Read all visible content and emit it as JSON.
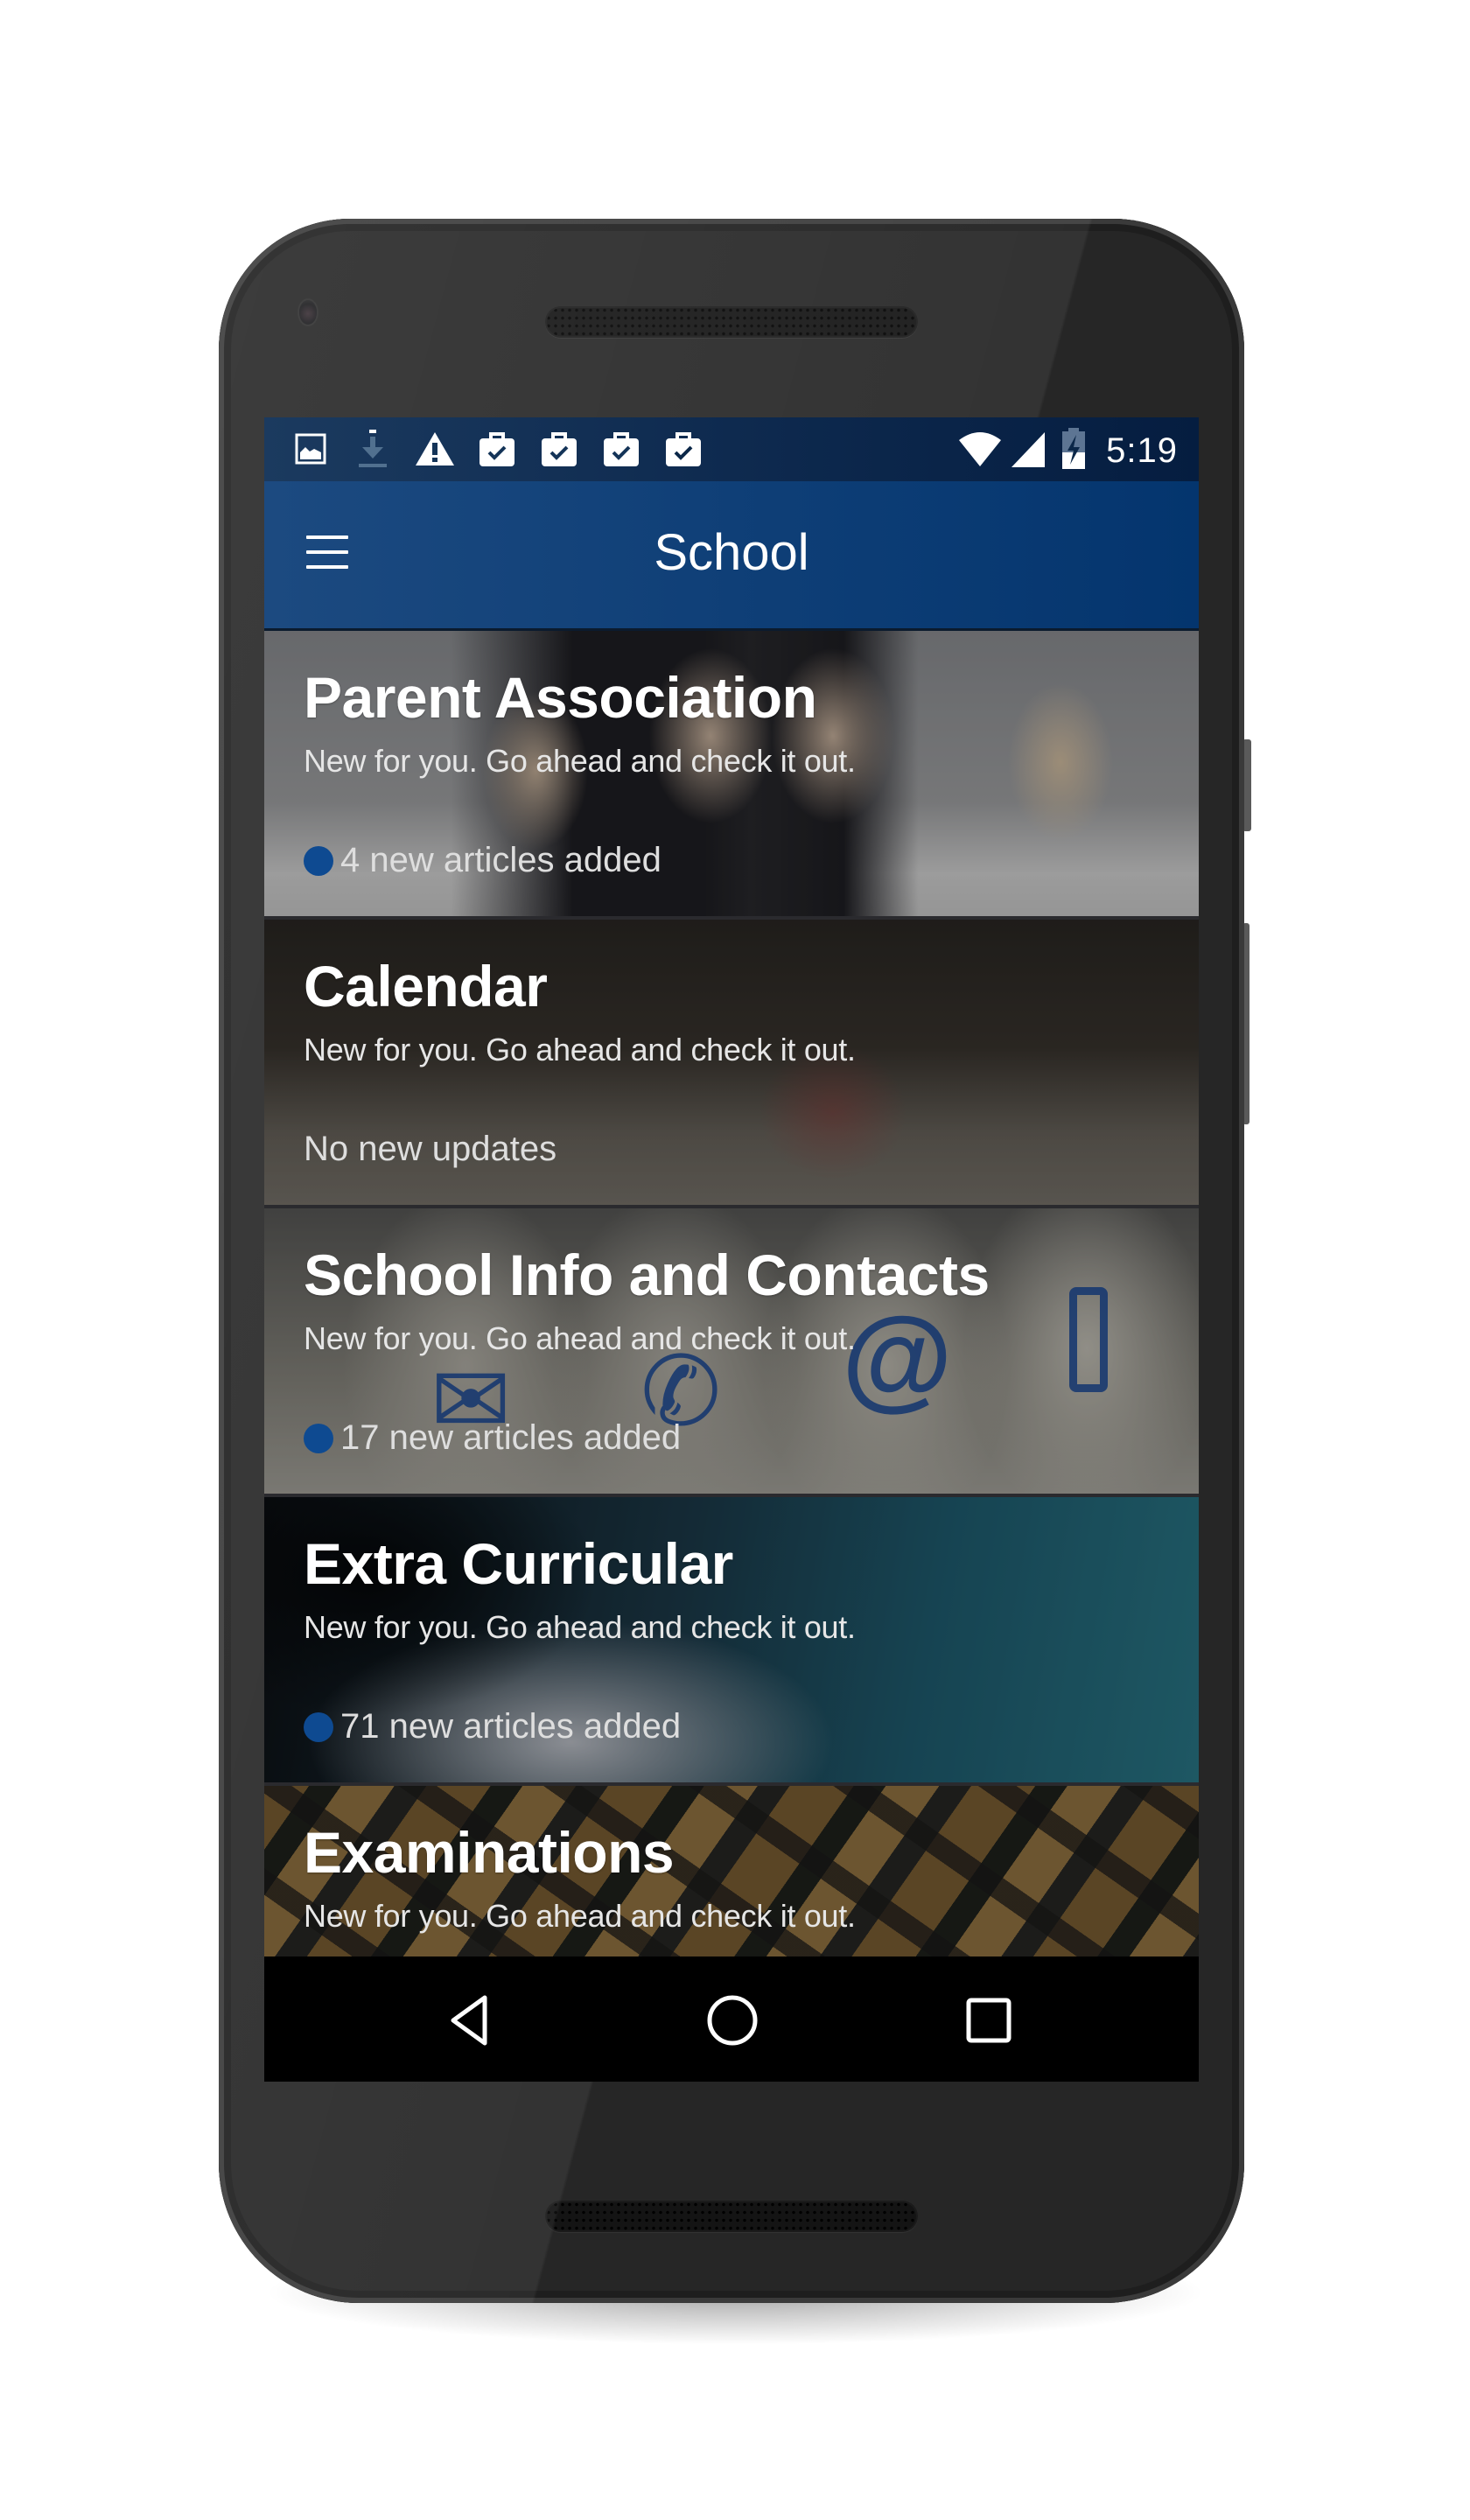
{
  "status_bar": {
    "notification_icons": [
      "image-icon",
      "download-icon",
      "warning-icon",
      "work-check-icon",
      "work-check-icon",
      "work-check-icon",
      "work-check-icon"
    ],
    "system_icons": [
      "wifi-icon",
      "cell-signal-icon",
      "battery-charging-icon"
    ],
    "time": "5:19"
  },
  "toolbar": {
    "title": "School",
    "menu_icon": "hamburger-menu-icon"
  },
  "colors": {
    "accent": "#0e4a91",
    "toolbar": "#0f3f77",
    "status_bar": "#0b2748"
  },
  "list": {
    "items": [
      {
        "title": "Parent Association",
        "subtitle": "New for you. Go ahead and check it out.",
        "status": "4 new articles added",
        "has_new": true
      },
      {
        "title": "Calendar",
        "subtitle": "New for you. Go ahead and check it out.",
        "status": "No new updates",
        "has_new": false
      },
      {
        "title": "School Info and Contacts",
        "subtitle": "New for you. Go ahead and check it out.",
        "status": "17 new articles added",
        "has_new": true
      },
      {
        "title": "Extra Curricular",
        "subtitle": "New for you. Go ahead and check it out.",
        "status": "71 new articles added",
        "has_new": true
      },
      {
        "title": "Examinations",
        "subtitle": "New for you. Go ahead and check it out.",
        "status": "",
        "has_new": false
      }
    ]
  },
  "nav_bar": {
    "buttons": [
      "back-icon",
      "home-icon",
      "recents-icon"
    ]
  }
}
